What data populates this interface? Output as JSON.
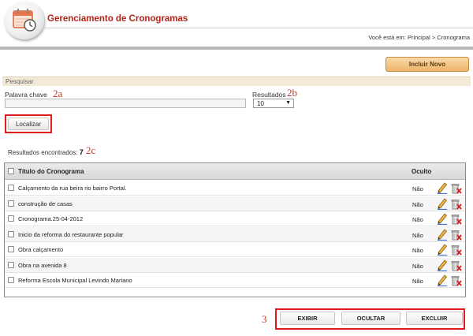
{
  "header": {
    "title": "Gerenciamento de Cronogramas",
    "breadcrumb_prefix": "Você está em:",
    "breadcrumb_items": [
      "Principal",
      "Cronograma"
    ],
    "breadcrumb_separator": ">",
    "logo_icon": "calendar-clock-icon"
  },
  "toolbar": {
    "new_label": "Incluir Novo"
  },
  "search": {
    "section_title": "Pesquisar",
    "keyword_label": "Palavra chave",
    "keyword_value": "",
    "results_label": "Resultados",
    "results_value": "10",
    "submit_label": "Localizar"
  },
  "results": {
    "found_label": "Resultados encontrados:",
    "found_count": "7"
  },
  "annotations": {
    "keyword": "2a",
    "results_select": "2b",
    "results_count": "2c",
    "actions": "3"
  },
  "table": {
    "columns": [
      "Título do Cronograma",
      "Oculto"
    ],
    "rows": [
      {
        "title": "Calçamento da rua beira rio bairro Portal.",
        "oculto": "Não"
      },
      {
        "title": "construção de casas",
        "oculto": "Não"
      },
      {
        "title": "Cronograma.25-04-2012",
        "oculto": "Não"
      },
      {
        "title": "Inicio da reforma do restaurante popular",
        "oculto": "Não"
      },
      {
        "title": "Obra calçamento",
        "oculto": "Não"
      },
      {
        "title": "Obra na avenida 8",
        "oculto": "Não"
      },
      {
        "title": "Reforma Escola Municipal Levindo Mariano",
        "oculto": "Não"
      }
    ],
    "row_icons": [
      "edit-pencil-icon",
      "delete-trash-icon"
    ]
  },
  "actions": {
    "show_label": "EXIBIR",
    "hide_label": "OCULTAR",
    "delete_label": "EXCLUIR"
  },
  "colors": {
    "title_red": "#b1241a",
    "highlight_red": "#e01a1a",
    "button_orange": "#eeb66b",
    "section_beige": "#f2ead7"
  }
}
